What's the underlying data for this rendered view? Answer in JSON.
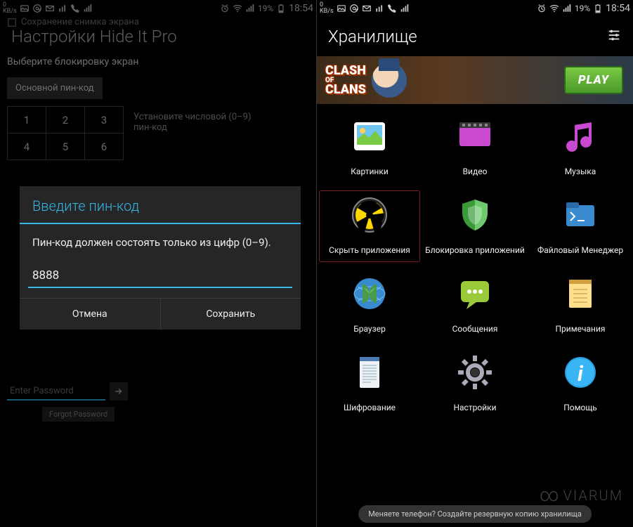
{
  "status": {
    "kbs_value": "0",
    "kbs_unit": "KB/s",
    "battery_pct": "19%",
    "time": "18:54"
  },
  "left": {
    "saving_toast": "Сохранение снимка экрана",
    "title": "Настройки Hide It Pro",
    "subtitle": "Выберите блокировку экран",
    "primary_tab": "Основной пин-код",
    "keypad": [
      "1",
      "2",
      "3",
      "4",
      "5",
      "6"
    ],
    "pin_hint": "Установите числовой (0–9) пин-код",
    "dialog": {
      "title": "Введите пин-код",
      "body": "Пин-код должен состоять только из цифр (0–9).",
      "value": "8888",
      "cancel": "Отмена",
      "save": "Сохранить"
    },
    "password_placeholder": "Enter Password",
    "forgot": "Forgot Password"
  },
  "right": {
    "title": "Хранилище",
    "ad": {
      "line1": "CLASH",
      "of": "OF",
      "line2": "CLANS",
      "play": "PLAY"
    },
    "tiles": [
      {
        "key": "pictures",
        "label": "Картинки"
      },
      {
        "key": "video",
        "label": "Видео"
      },
      {
        "key": "music",
        "label": "Музыка"
      },
      {
        "key": "hide-apps",
        "label": "Скрыть приложения",
        "highlighted": true
      },
      {
        "key": "lock-apps",
        "label": "Блокировка приложений"
      },
      {
        "key": "file-manager",
        "label": "Файловый Менеджер"
      },
      {
        "key": "browser",
        "label": "Браузер"
      },
      {
        "key": "messages",
        "label": "Сообщения"
      },
      {
        "key": "notes",
        "label": "Примечания"
      },
      {
        "key": "encryption",
        "label": "Шифрование"
      },
      {
        "key": "settings",
        "label": "Настройки"
      },
      {
        "key": "help",
        "label": "Помощь"
      }
    ],
    "footer": "Меняете телефон? Создайте резервную копию хранилища"
  },
  "watermark": "VIARUM"
}
